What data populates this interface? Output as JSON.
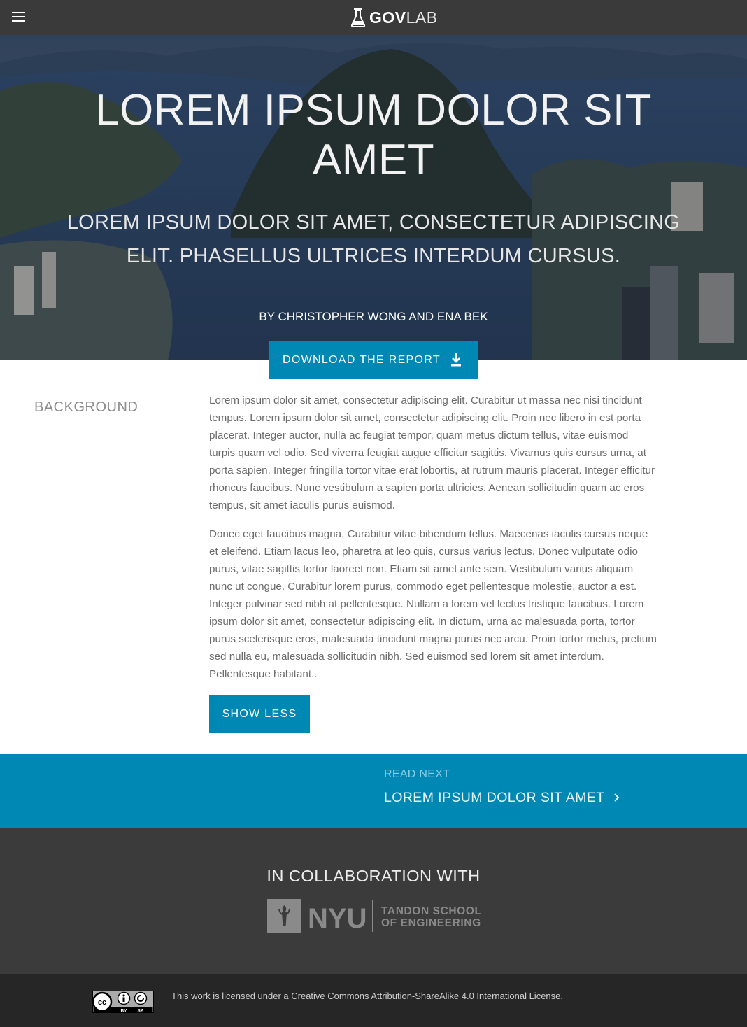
{
  "header": {
    "logo_bold": "GOV",
    "logo_light": "LAB"
  },
  "hero": {
    "title": "LOREM IPSUM DOLOR SIT AMET",
    "subtitle": "LOREM IPSUM DOLOR SIT AMET, CONSECTETUR ADIPISCING ELIT. PHASELLUS ULTRICES INTERDUM CURSUS.",
    "byline": "BY CHRISTOPHER WONG AND ENA BEK",
    "download_label": "DOWNLOAD THE REPORT"
  },
  "content": {
    "section_label": "BACKGROUND",
    "paragraphs": [
      "Lorem ipsum dolor sit amet, consectetur adipiscing elit. Curabitur ut massa nec nisi tincidunt tempus. Lorem ipsum dolor sit amet, consectetur adipiscing elit. Proin nec libero in est porta placerat. Integer auctor, nulla ac feugiat tempor, quam metus dictum tellus, vitae euismod turpis quam vel odio. Sed viverra feugiat augue efficitur sagittis. Vivamus quis cursus urna, at porta sapien. Integer fringilla tortor vitae erat lobortis, at rutrum mauris placerat. Integer efficitur rhoncus faucibus. Nunc vestibulum a sapien porta ultricies. Aenean sollicitudin quam ac eros tempus, sit amet iaculis purus euismod.",
      "Donec eget faucibus magna. Curabitur vitae bibendum tellus. Maecenas iaculis cursus neque et eleifend. Etiam lacus leo, pharetra at leo quis, cursus varius lectus. Donec vulputate odio purus, vitae sagittis tortor laoreet non. Etiam sit amet ante sem. Vestibulum varius aliquam nunc ut congue. Curabitur lorem purus, commodo eget pellentesque molestie, auctor a est. Integer pulvinar sed nibh at pellentesque. Nullam a lorem vel lectus tristique faucibus. Lorem ipsum dolor sit amet, consectetur adipiscing elit. In dictum, urna ac malesuada porta, tortor purus scelerisque eros, malesuada tincidunt magna purus nec arcu. Proin tortor metus, pretium sed nulla eu, malesuada sollicitudin nibh. Sed euismod sed lorem sit amet interdum. Pellentesque habitant.."
    ],
    "toggle_label": "SHOW LESS"
  },
  "read_next": {
    "label": "READ NEXT",
    "title": "LOREM IPSUM DOLOR SIT AMET"
  },
  "collaboration": {
    "title": "IN COLLABORATION WITH",
    "partner_name": "NYU",
    "partner_school_line1": "TANDON SCHOOL",
    "partner_school_line2": "OF ENGINEERING"
  },
  "footer": {
    "license_text": "This work is licensed under a Creative Commons Attribution-ShareAlike 4.0 International License.",
    "badge_by": "BY",
    "badge_sa": "SA"
  },
  "colors": {
    "accent": "#0088b5",
    "nav_bg": "#3a3a3a",
    "collab_bg": "#3b3b3b",
    "footer_bg": "#262626"
  },
  "icons": {
    "menu": "hamburger-menu-icon",
    "logo": "flask-icon",
    "download": "download-arrow-icon",
    "read_next": "chevron-right-icon",
    "license": "creative-commons-badge"
  }
}
